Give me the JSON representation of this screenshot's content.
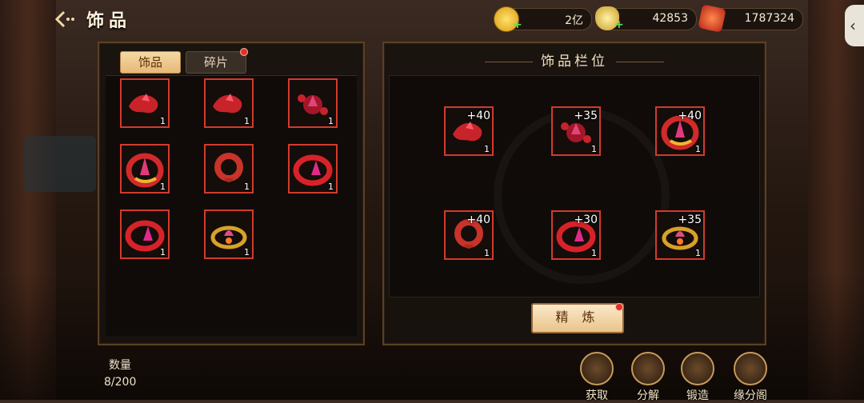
{
  "header": {
    "title": "饰品"
  },
  "currency": [
    {
      "name": "gold-coin-icon",
      "value": "2亿",
      "plus": "+"
    },
    {
      "name": "silver-ingot-icon",
      "value": "42853",
      "plus": "+"
    },
    {
      "name": "jade-token-icon",
      "value": "1787324"
    }
  ],
  "tabs": {
    "accessories": "饰品",
    "fragments": "碎片"
  },
  "slots_panel": {
    "title": "饰品栏位"
  },
  "inventory": [
    {
      "icon": "red-gem-charm-icon",
      "count": "1"
    },
    {
      "icon": "red-gem-charm-icon",
      "count": "1"
    },
    {
      "icon": "crimson-flower-brooch-icon",
      "count": "1"
    },
    {
      "icon": "gold-crystal-ring-icon",
      "count": "1"
    },
    {
      "icon": "red-knot-pendant-icon",
      "count": "1"
    },
    {
      "icon": "ruby-ring-icon",
      "count": "1"
    },
    {
      "icon": "ruby-ring-icon",
      "count": "1"
    },
    {
      "icon": "gold-lotus-ring-icon",
      "count": "1"
    }
  ],
  "equipped": [
    {
      "icon": "red-gem-charm-icon",
      "level": "+40",
      "count": "1"
    },
    {
      "icon": "crimson-flower-brooch-icon",
      "level": "+35",
      "count": "1"
    },
    {
      "icon": "gold-crystal-ring-icon",
      "level": "+40",
      "count": "1"
    },
    {
      "icon": "red-knot-pendant-icon",
      "level": "+40",
      "count": "1"
    },
    {
      "icon": "ruby-ring-icon",
      "level": "+30",
      "count": "1"
    },
    {
      "icon": "gold-lotus-ring-icon",
      "level": "+35",
      "count": "1"
    }
  ],
  "refine_button": "精 炼",
  "count": {
    "label": "数量",
    "value": "8/200"
  },
  "actions": [
    {
      "label": "获取",
      "icon": "obtain-icon"
    },
    {
      "label": "分解",
      "icon": "decompose-icon"
    },
    {
      "label": "锻造",
      "icon": "forge-hammer-icon"
    },
    {
      "label": "缘分阁",
      "icon": "pavilion-icon"
    }
  ],
  "colors": {
    "slot_border": "#d23a2c",
    "accent": "#e6b978",
    "panel_border": "#5a4024"
  }
}
